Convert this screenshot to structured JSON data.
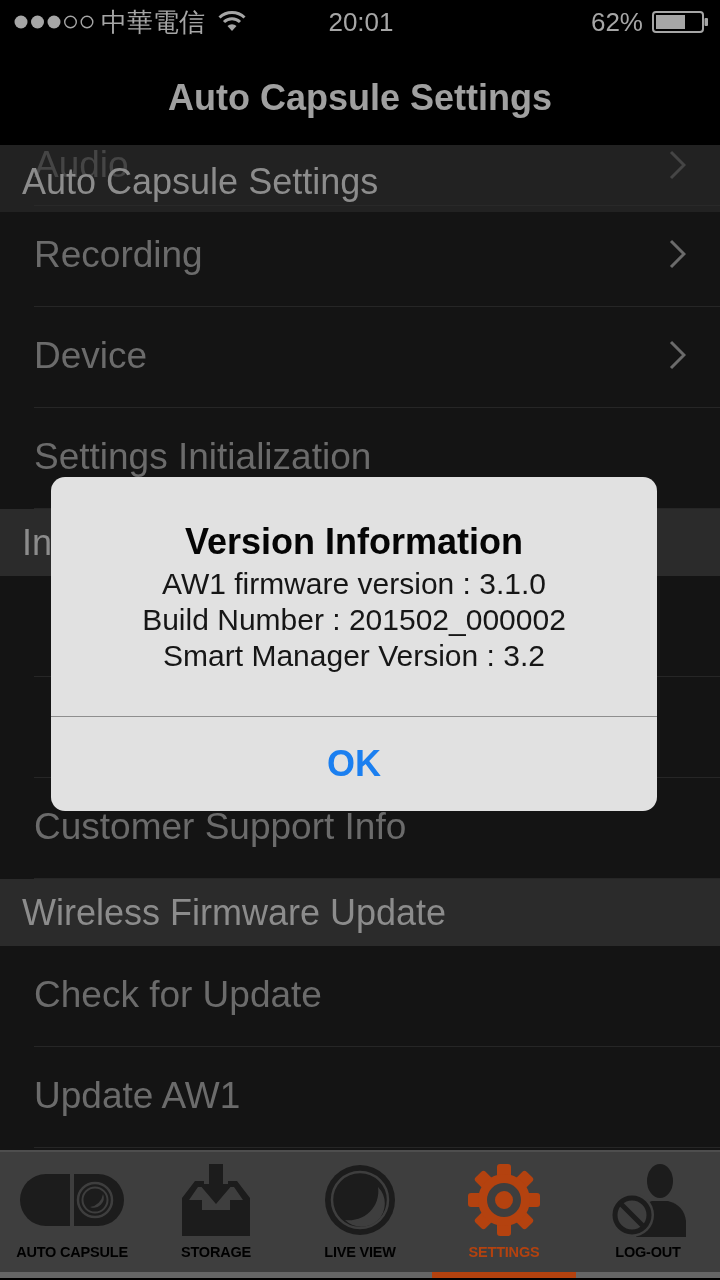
{
  "status_bar": {
    "carrier": "中華電信",
    "time": "20:01",
    "battery": "62%"
  },
  "nav_bar": {
    "title": "Auto Capsule Settings"
  },
  "sections": [
    {
      "header": "Auto Capsule Settings",
      "items": [
        {
          "kind": "entry",
          "label": "Audio",
          "disclosure": true,
          "selected": false
        },
        {
          "kind": "entry",
          "label": "Recording",
          "disclosure": true,
          "selected": false
        },
        {
          "kind": "entry",
          "label": "Device",
          "disclosure": true,
          "selected": false
        },
        {
          "kind": "entry",
          "label": "Settings Initialization",
          "disclosure": false,
          "selected": false
        }
      ]
    },
    {
      "header": "In",
      "items": [
        {
          "kind": "blank"
        },
        {
          "kind": "blank"
        },
        {
          "kind": "entry",
          "label": "Customer Support Info",
          "disclosure": false,
          "selected": false
        }
      ]
    },
    {
      "header": "Wireless Firmware Update",
      "items": [
        {
          "kind": "entry",
          "label": "Check for Update",
          "disclosure": false,
          "selected": false
        },
        {
          "kind": "entry",
          "label": "Update AW1",
          "disclosure": false,
          "selected": false
        }
      ]
    }
  ],
  "alert": {
    "title": "Version Information",
    "lines": [
      "AW1 firmware version : 3.1.0",
      "Build Number : 201502_000002",
      "Smart Manager Version : 3.2"
    ],
    "button": "OK"
  },
  "tab_bar": {
    "tabs": [
      {
        "kind": "capsule",
        "label": "AUTO CAPSULE",
        "selected": false
      },
      {
        "kind": "storage",
        "label": "STORAGE",
        "selected": false
      },
      {
        "kind": "live",
        "label": "LIVE VIEW",
        "selected": false
      },
      {
        "kind": "settings",
        "label": "SETTINGS",
        "selected": true
      },
      {
        "kind": "logout",
        "label": "LOG-OUT",
        "selected": false
      }
    ]
  }
}
